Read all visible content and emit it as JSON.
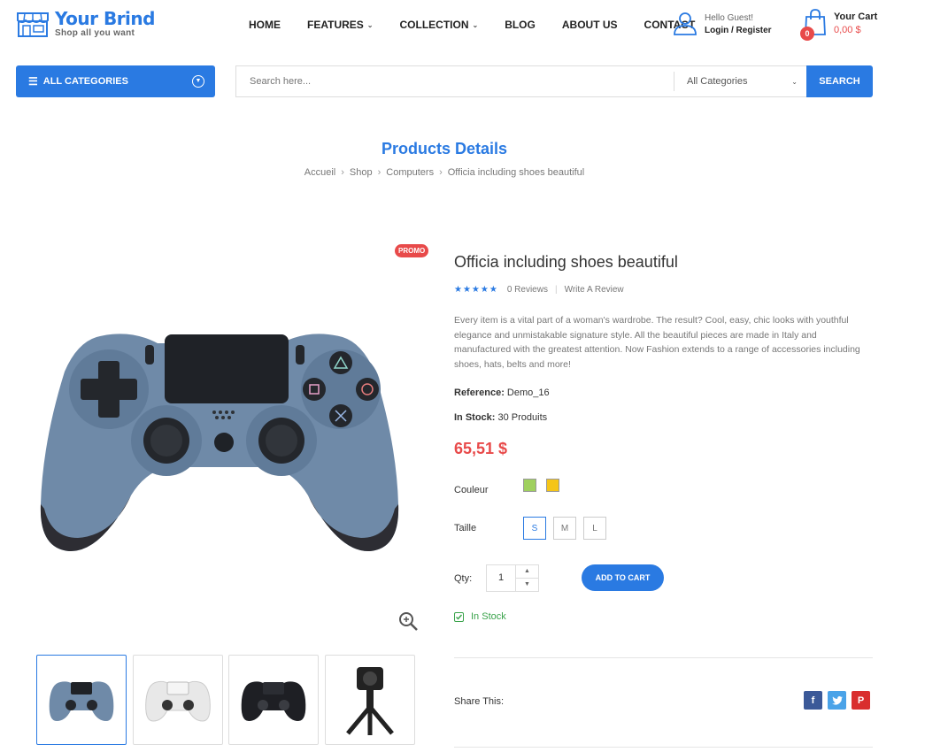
{
  "brand": {
    "name": "Your Brind",
    "tagline": "Shop all you want"
  },
  "nav": [
    {
      "label": "HOME",
      "dropdown": false
    },
    {
      "label": "FEATURES",
      "dropdown": true
    },
    {
      "label": "COLLECTION",
      "dropdown": true
    },
    {
      "label": "BLOG",
      "dropdown": false
    },
    {
      "label": "ABOUT US",
      "dropdown": false
    },
    {
      "label": "CONTACT",
      "dropdown": false
    }
  ],
  "account": {
    "greeting": "Hello Guest!",
    "login": "Login / Register"
  },
  "cart": {
    "label": "Your Cart",
    "total": "0,00 $",
    "count": "0"
  },
  "search": {
    "categories_button": "ALL CATEGORIES",
    "placeholder": "Search here...",
    "category_select": "All Categories",
    "button": "SEARCH"
  },
  "page": {
    "title": "Products Details",
    "breadcrumb": [
      "Accueil",
      "Shop",
      "Computers",
      "Officia including shoes beautiful"
    ]
  },
  "product": {
    "badge": "PROMO",
    "name": "Officia including shoes beautiful",
    "stars": "★★★★★",
    "reviews": "0 Reviews",
    "write_review": "Write A Review",
    "description": "Every item is a vital part of a woman's wardrobe. The result? Cool, easy, chic looks with youthful elegance and unmistakable signature style. All the beautiful pieces are made in Italy and manufactured with the greatest attention. Now Fashion extends to a range of accessories including shoes, hats, belts and more!",
    "reference_label": "Reference:",
    "reference": "Demo_16",
    "stock_label": "In Stock:",
    "stock": "30 Produits",
    "price": "65,51 $",
    "color_label": "Couleur",
    "colors": [
      "#9fd05e",
      "#f5c518"
    ],
    "size_label": "Taille",
    "sizes": [
      "S",
      "M",
      "L"
    ],
    "selected_size": "S",
    "qty_label": "Qty:",
    "qty": "1",
    "add_to_cart": "ADD TO CART",
    "availability": "In Stock",
    "share_label": "Share This:",
    "thumbnails": [
      "controller-blue",
      "controller-white",
      "controller-black",
      "camera-tripod"
    ]
  },
  "colors": {
    "accent": "#2a7ae2",
    "sale": "#e84a4a",
    "stock": "#3aa34b",
    "facebook": "#3b5998",
    "twitter": "#4aa3e8",
    "pinterest": "#d92e2e"
  }
}
